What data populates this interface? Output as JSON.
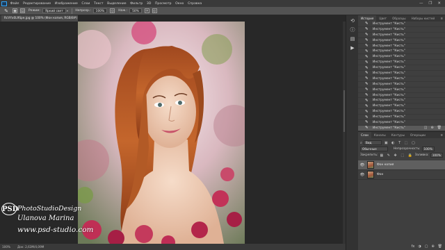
{
  "menubar": {
    "items": [
      "Файл",
      "Редактирование",
      "Изображение",
      "Слои",
      "Текст",
      "Выделение",
      "Фильтр",
      "3D",
      "Просмотр",
      "Окно",
      "Справка"
    ],
    "window_controls": [
      "—",
      "❐",
      "✕"
    ]
  },
  "options": {
    "mode_label": "Режим:",
    "mode_value": "Яркий свет",
    "opacity_label": "Непрозр.:",
    "opacity_value": "100%",
    "flow_label": "Наж.:",
    "flow_value": "50%"
  },
  "document": {
    "tab_title": "RcVYx0L9Spe.jpg @ 100% (Фон копия, RGB/8#) *",
    "close": "✕"
  },
  "status": {
    "zoom": "100%",
    "doc": "Док: 2,63M/4,09M"
  },
  "watermark": {
    "logo": "PSD",
    "studio": "PhotoStudioDesign",
    "author": "Ulanova Marina",
    "site": "www.psd-studio.com"
  },
  "icon_strip": [
    "history-icon",
    "info-icon",
    "layers-icon",
    "actions-icon"
  ],
  "history": {
    "tabs": [
      "История",
      "Цвет",
      "Образцы",
      "Наборы кистей"
    ],
    "menu": "≡",
    "item_label": "Инструмент \"Кисть\"",
    "rows": 20,
    "selected_index": 19,
    "footer": [
      "◫",
      "⊕",
      "🗑"
    ]
  },
  "layers": {
    "tabs": [
      "Слои",
      "Каналы",
      "Контуры",
      "Операции"
    ],
    "menu": "≡",
    "kind_label": "Вид",
    "blend_mode": "Обычные",
    "opacity_label": "Непрозрачность:",
    "opacity_value": "100%",
    "lock_label": "Закрепить:",
    "fill_label": "Заливка:",
    "fill_value": "100%",
    "items": [
      {
        "name": "Фон копия",
        "selected": true
      },
      {
        "name": "Фон",
        "selected": false
      }
    ],
    "footer": [
      "fx",
      "◑",
      "▢",
      "⊕",
      "🗑"
    ]
  },
  "colors": {
    "accent": "#31a8ff",
    "panel": "#3f3f3f",
    "workspace": "#282828"
  }
}
